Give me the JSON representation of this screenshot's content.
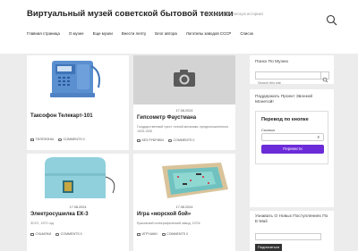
{
  "header": {
    "title": "Виртуальный музей советской бытовой техники",
    "description": "Сохраняя техническую историю!"
  },
  "nav": [
    "Главная страница",
    "О музее",
    "Еще музеи",
    "Внести лепту",
    "Блог автора",
    "Логотипы заводов СССР",
    "Список"
  ],
  "posts": [
    {
      "date": "",
      "title": "Таксофон Телекарт-101",
      "excerpt": "",
      "category": "ТЕЛЕФОНЫ",
      "comments": "COMMENTS 0"
    },
    {
      "date": "17.08.2024",
      "title": "Гипсометр Фаустмана",
      "excerpt": "Государственный трест точной механики, предположительно 1925-1930",
      "category": "БЕЗ РУБРИКИ",
      "comments": "COMMENTS 0"
    },
    {
      "date": "17.08.2024",
      "title": "Электросушилка ЕК-3",
      "excerpt": "ЗСУС, 1971 год",
      "category": "СУШИЛКИ",
      "comments": "COMMENTS 0"
    },
    {
      "date": "17.08.2024",
      "title": "Игра «морской бой»",
      "excerpt": "Ершовский полиграфический завод, 1970г.",
      "category": "ИГРУШКИ",
      "comments": "COMMENTS 0"
    }
  ],
  "sidebar": {
    "search_title": "Поиск По Музею",
    "search_placeholder": "Search this site",
    "donate_title": "Поддержать Проект Звонкой Монетой!",
    "donate_box_title": "Перевод по кнопке",
    "donate_amount_label": "Сколько",
    "donate_currency": "₽",
    "donate_button": "Перевести",
    "donate_button_color": "#6c2bd9",
    "subscribe_title": "Узнавать О Новых Поступлениях По E-Mail",
    "subscribe_button": "Подписаться"
  }
}
